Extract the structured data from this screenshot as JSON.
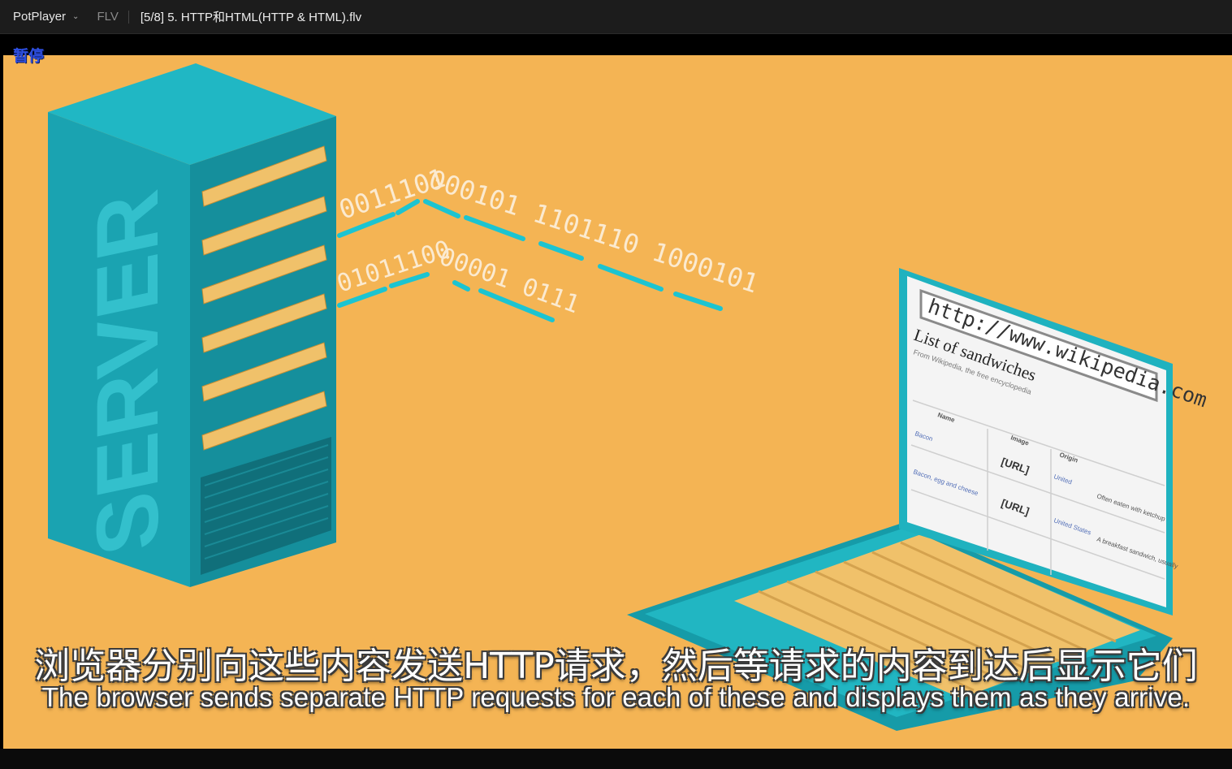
{
  "window": {
    "app_name": "PotPlayer",
    "format": "FLV",
    "file_title": "[5/8] 5. HTTP和HTML(HTTP & HTML).flv"
  },
  "player": {
    "status": "暂停"
  },
  "video_frame": {
    "server_label": "SERVER",
    "binary_line_1": "0011101 000101 1101110 1000101",
    "binary_line_2": "01011100 00001 0111",
    "browser_url": "http://www.wikipedia.com",
    "page_heading": "List of sandwiches",
    "page_subheading": "From Wikipedia, the free encyclopedia",
    "table_headers": [
      "Name",
      "Image",
      "Origin"
    ],
    "table_rows": [
      {
        "name": "Bacon",
        "image": "[URL]",
        "origin": "United Kingdom",
        "desc": "Often eaten with ketchup"
      },
      {
        "name": "Bacon, egg and cheese",
        "image": "[URL]",
        "origin": "United States",
        "desc": "A breakfast sandwich, usually"
      }
    ]
  },
  "subtitles": {
    "chinese": "浏览器分别向这些内容发送HTTP请求，然后等请求的内容到达后显示它们",
    "english": "The browser sends separate HTTP requests for each of these and displays them as they arrive."
  },
  "colors": {
    "background": "#f4b454",
    "server": "#1ea7b5",
    "accent": "#f0c16a",
    "subtitle_outline": "#3a3a3a",
    "status_text": "#2e4fe0"
  }
}
